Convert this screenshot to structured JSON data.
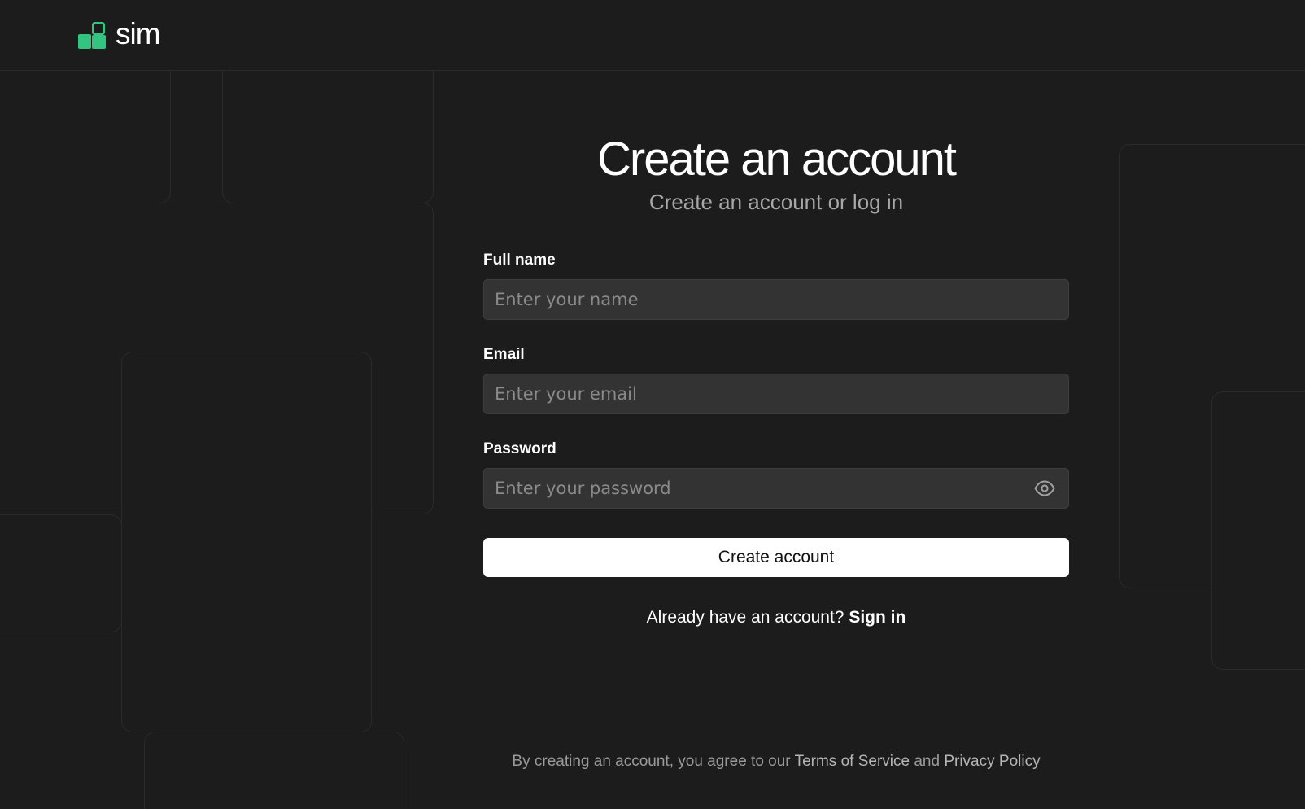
{
  "brand": {
    "name": "sim",
    "accent_color": "#33c482"
  },
  "form": {
    "title": "Create an account",
    "subtitle": "Create an account or log in",
    "name_label": "Full name",
    "name_placeholder": "Enter your name",
    "email_label": "Email",
    "email_placeholder": "Enter your email",
    "password_label": "Password",
    "password_placeholder": "Enter your password",
    "password_toggle_icon": "eye-icon",
    "submit_label": "Create account",
    "signin_prompt": "Already have an account?",
    "signin_link": "Sign in"
  },
  "footer": {
    "prefix": "By creating an account, you agree to our",
    "terms_link": "Terms of Service",
    "conjunction": "and",
    "privacy_link": "Privacy Policy"
  }
}
